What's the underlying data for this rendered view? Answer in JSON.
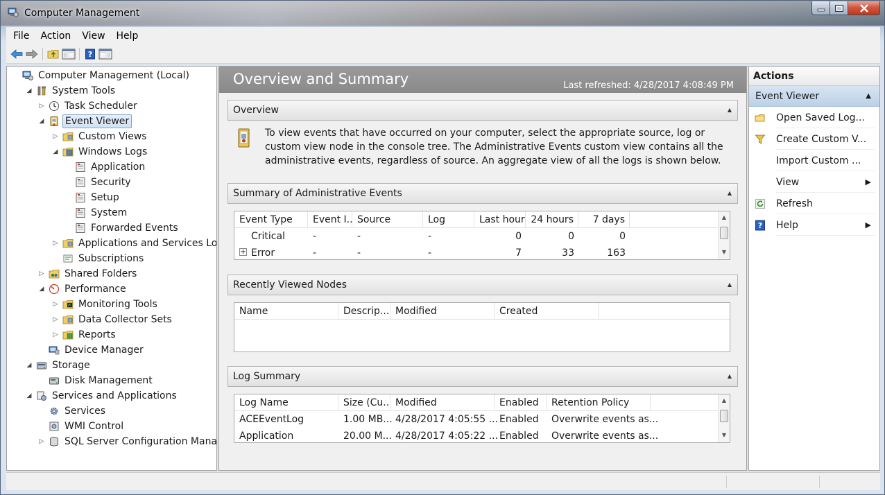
{
  "window": {
    "title": "Computer Management"
  },
  "menu": [
    "File",
    "Action",
    "View",
    "Help"
  ],
  "tree": [
    {
      "label": "Computer Management (Local)",
      "level": 0,
      "exp": "",
      "icon": "computer-icon"
    },
    {
      "label": "System Tools",
      "level": 1,
      "exp": "open",
      "icon": "tools-icon"
    },
    {
      "label": "Task Scheduler",
      "level": 2,
      "exp": "closed",
      "icon": "clock-icon"
    },
    {
      "label": "Event Viewer",
      "level": 2,
      "exp": "open",
      "icon": "event-viewer-icon",
      "selected": true
    },
    {
      "label": "Custom Views",
      "level": 3,
      "exp": "closed",
      "icon": "folder-icon"
    },
    {
      "label": "Windows Logs",
      "level": 3,
      "exp": "open",
      "icon": "folder-log-icon"
    },
    {
      "label": "Application",
      "level": 4,
      "exp": "",
      "icon": "log-icon"
    },
    {
      "label": "Security",
      "level": 4,
      "exp": "",
      "icon": "log-icon"
    },
    {
      "label": "Setup",
      "level": 4,
      "exp": "",
      "icon": "log-icon"
    },
    {
      "label": "System",
      "level": 4,
      "exp": "",
      "icon": "log-icon"
    },
    {
      "label": "Forwarded Events",
      "level": 4,
      "exp": "",
      "icon": "log-icon"
    },
    {
      "label": "Applications and Services Logs",
      "level": 3,
      "exp": "closed",
      "icon": "folder-icon"
    },
    {
      "label": "Subscriptions",
      "level": 3,
      "exp": "",
      "icon": "subscriptions-icon"
    },
    {
      "label": "Shared Folders",
      "level": 2,
      "exp": "closed",
      "icon": "shared-folder-icon"
    },
    {
      "label": "Performance",
      "level": 2,
      "exp": "open",
      "icon": "performance-icon"
    },
    {
      "label": "Monitoring Tools",
      "level": 3,
      "exp": "closed",
      "icon": "monitor-folder-icon"
    },
    {
      "label": "Data Collector Sets",
      "level": 3,
      "exp": "closed",
      "icon": "folder-icon"
    },
    {
      "label": "Reports",
      "level": 3,
      "exp": "closed",
      "icon": "reports-icon"
    },
    {
      "label": "Device Manager",
      "level": 2,
      "exp": "",
      "icon": "device-manager-icon"
    },
    {
      "label": "Storage",
      "level": 1,
      "exp": "open",
      "icon": "storage-icon"
    },
    {
      "label": "Disk Management",
      "level": 2,
      "exp": "",
      "icon": "disk-icon"
    },
    {
      "label": "Services and Applications",
      "level": 1,
      "exp": "open",
      "icon": "services-apps-icon"
    },
    {
      "label": "Services",
      "level": 2,
      "exp": "",
      "icon": "gear-icon"
    },
    {
      "label": "WMI Control",
      "level": 2,
      "exp": "",
      "icon": "wmi-icon"
    },
    {
      "label": "SQL Server Configuration Manager",
      "level": 2,
      "exp": "closed",
      "icon": "sql-icon"
    }
  ],
  "center": {
    "title": "Overview and Summary",
    "last_refreshed": "Last refreshed: 4/28/2017 4:08:49 PM",
    "overview": {
      "header": "Overview",
      "text": "To view events that have occurred on your computer, select the appropriate source, log or custom view node in the console tree. The Administrative Events custom view contains all the administrative events, regardless of source. An aggregate view of all the logs is shown below."
    },
    "admin_events": {
      "header": "Summary of Administrative Events",
      "columns": [
        "Event Type",
        "Event I...",
        "Source",
        "Log",
        "Last hour",
        "24 hours",
        "7 days"
      ],
      "rows": [
        [
          "Critical",
          "-",
          "-",
          "-",
          "0",
          "0",
          "0"
        ],
        [
          "Error",
          "-",
          "-",
          "-",
          "7",
          "33",
          "163"
        ]
      ]
    },
    "recent_nodes": {
      "header": "Recently Viewed Nodes",
      "columns": [
        "Name",
        "Descrip...",
        "Modified",
        "Created"
      ]
    },
    "log_summary": {
      "header": "Log Summary",
      "columns": [
        "Log Name",
        "Size (Cu...",
        "Modified",
        "Enabled",
        "Retention Policy"
      ],
      "rows": [
        [
          "ACEEventLog",
          "1.00 MB...",
          "4/28/2017 4:05:55 ...",
          "Enabled",
          "Overwrite events as..."
        ],
        [
          "Application",
          "20.00 M...",
          "4/28/2017 4:05:22 ...",
          "Enabled",
          "Overwrite events as..."
        ]
      ]
    }
  },
  "actions": {
    "header": "Actions",
    "subheader": "Event Viewer",
    "items": [
      {
        "label": "Open Saved Log...",
        "icon": "open-log-icon",
        "submenu": false
      },
      {
        "label": "Create Custom V...",
        "icon": "filter-icon",
        "submenu": false
      },
      {
        "label": "Import Custom ...",
        "icon": "",
        "submenu": false
      },
      {
        "label": "View",
        "icon": "",
        "submenu": true
      },
      {
        "label": "Refresh",
        "icon": "refresh-icon",
        "submenu": false
      },
      {
        "label": "Help",
        "icon": "help-icon",
        "submenu": true
      }
    ]
  }
}
